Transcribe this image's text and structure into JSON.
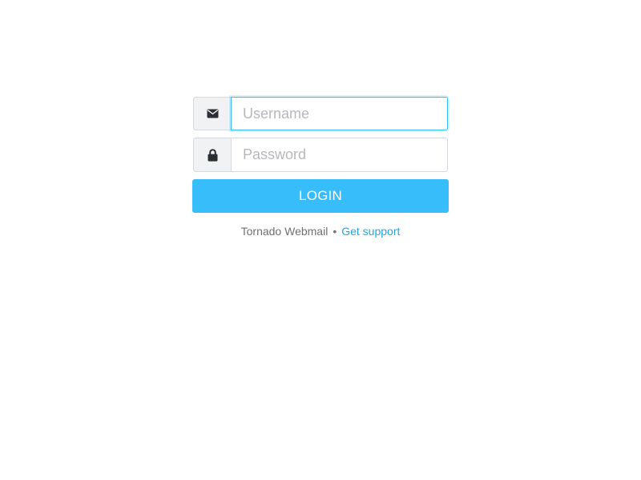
{
  "login": {
    "username": {
      "placeholder": "Username",
      "value": "",
      "icon": "envelope-icon"
    },
    "password": {
      "placeholder": "Password",
      "value": "",
      "icon": "lock-icon"
    },
    "button_label": "LOGIN"
  },
  "footer": {
    "product_name": "Tornado Webmail",
    "separator": "•",
    "support_link": "Get support"
  },
  "colors": {
    "accent": "#37bdfa",
    "link": "#1da8e0",
    "addon_background": "#f1f2f4",
    "border": "#d6d9de",
    "focus_border": "#37bcf5"
  }
}
